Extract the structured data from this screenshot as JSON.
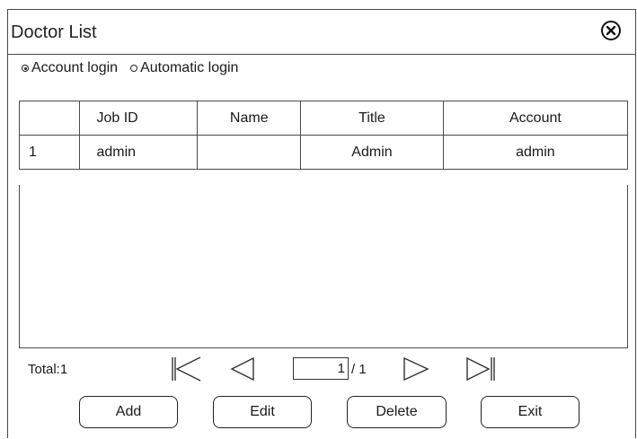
{
  "dialog": {
    "title": "Doctor List"
  },
  "login_mode": {
    "options": [
      {
        "label": "Account login",
        "selected": true
      },
      {
        "label": "Automatic login",
        "selected": false
      }
    ]
  },
  "table": {
    "headers": [
      "",
      "Job ID",
      "Name",
      "Title",
      "Account"
    ],
    "rows": [
      {
        "index": "1",
        "job_id": "admin",
        "name": "",
        "title": "Admin",
        "account": "admin"
      }
    ]
  },
  "pager": {
    "total_label": "Total:1",
    "current_page": "1",
    "page_of": "/ 1"
  },
  "buttons": {
    "add": "Add",
    "edit": "Edit",
    "delete": "Delete",
    "exit": "Exit"
  },
  "icons": [
    "close-icon",
    "first-page-icon",
    "prev-page-icon",
    "next-page-icon",
    "last-page-icon"
  ]
}
